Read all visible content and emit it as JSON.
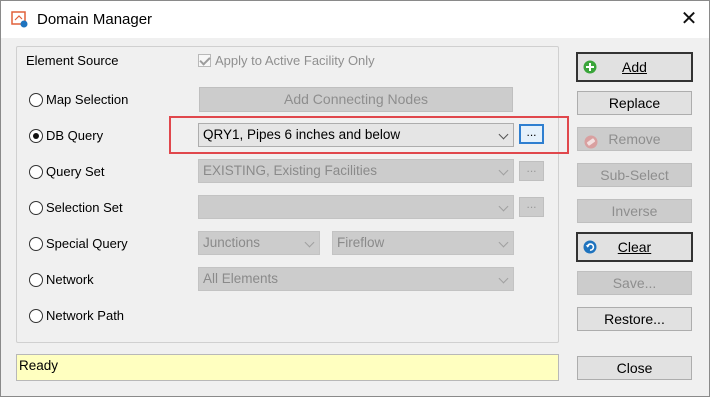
{
  "window": {
    "title": "Domain Manager",
    "close_glyph": "✕",
    "app_icon": "domain-manager-icon"
  },
  "element_source": {
    "label": "Element Source",
    "apply_checkbox": {
      "label": "Apply to Active Facility Only",
      "checked": true,
      "enabled": false
    }
  },
  "sources": [
    {
      "label": "Map Selection",
      "selected": false
    },
    {
      "label": "DB Query",
      "selected": true
    },
    {
      "label": "Query Set",
      "selected": false
    },
    {
      "label": "Selection Set",
      "selected": false
    },
    {
      "label": "Special Query",
      "selected": false
    },
    {
      "label": "Network",
      "selected": false
    },
    {
      "label": "Network Path",
      "selected": false
    }
  ],
  "controls": {
    "add_connecting_nodes": "Add Connecting Nodes",
    "db_query_value": "QRY1, Pipes 6 inches and below",
    "query_set_value": "EXISTING, Existing Facilities",
    "selection_set_value": "",
    "special_query_type": "Junctions",
    "special_query_value": "Fireflow",
    "network_value": "All Elements",
    "ellipsis_label": "..."
  },
  "buttons": {
    "add": {
      "label": "Add",
      "icon": "plus-circle-icon",
      "color": "#3aa53a"
    },
    "replace": {
      "label": "Replace"
    },
    "remove": {
      "label": "Remove",
      "icon": "eraser-icon"
    },
    "sub_select": {
      "label": "Sub-Select"
    },
    "inverse": {
      "label": "Inverse"
    },
    "clear": {
      "label": "Clear",
      "icon": "undo-circle-icon",
      "color": "#1e73be"
    },
    "save": {
      "label": "Save..."
    },
    "restore": {
      "label": "Restore..."
    },
    "close": {
      "label": "Close"
    }
  },
  "status": {
    "text": "Ready"
  },
  "colors": {
    "highlight": "#e0474c",
    "status_bg": "#ffffc0",
    "focus": "#2f7fd0"
  }
}
